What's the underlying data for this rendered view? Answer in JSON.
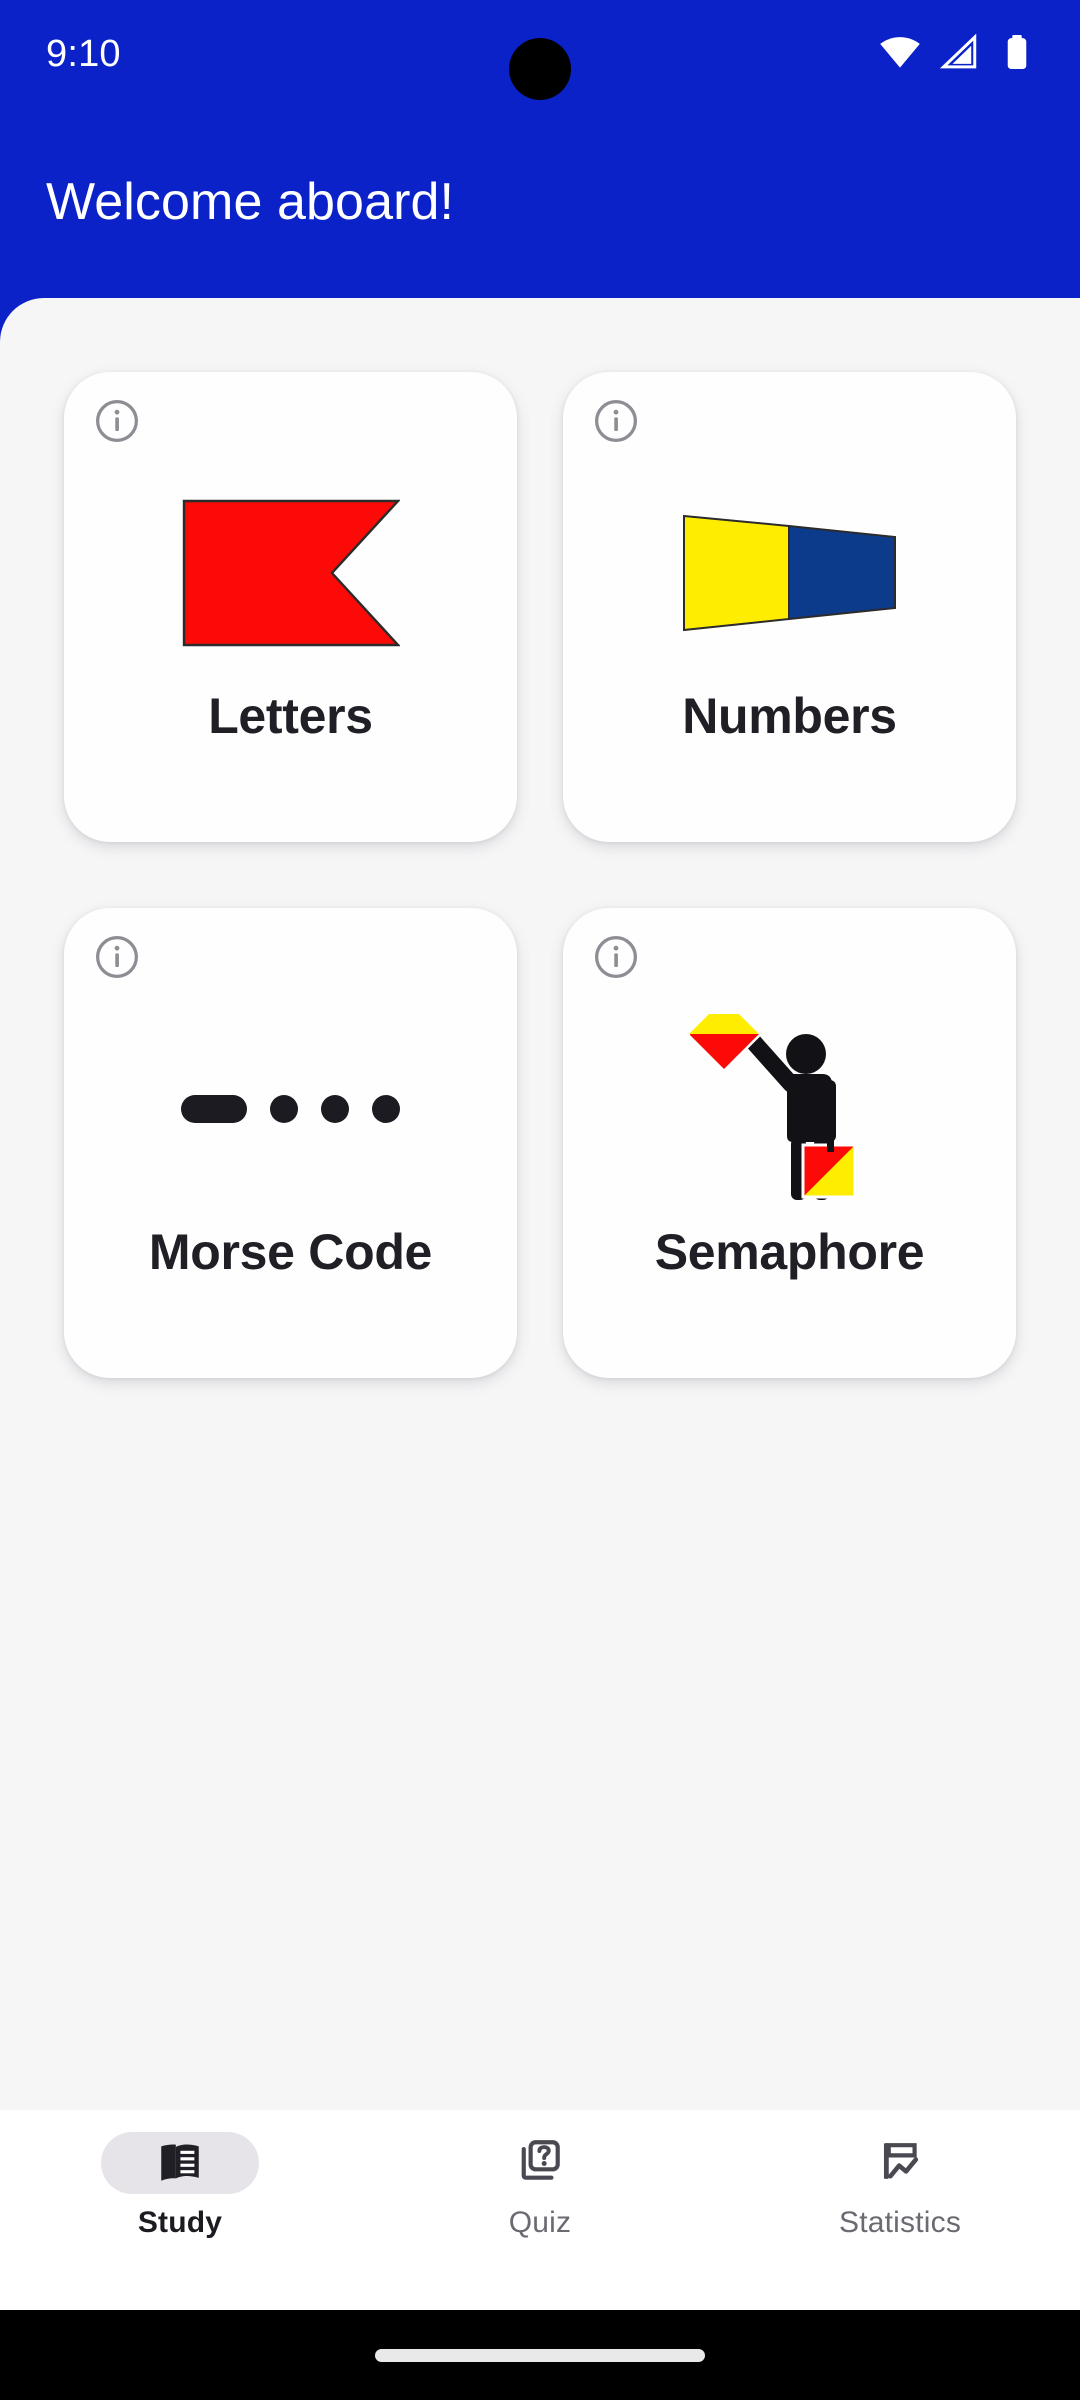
{
  "status_bar": {
    "clock": "9:10",
    "icons": [
      "wifi-icon",
      "cellular-signal-icon",
      "battery-icon"
    ],
    "wifi_level": "full",
    "cellular_level": "partial",
    "battery_level": "full"
  },
  "app_bar": {
    "title": "Welcome aboard!",
    "background_color": "#0B22C8",
    "text_color": "#FFFFFF"
  },
  "theme": {
    "primary": "#0B22C8",
    "sheet_background": "#F6F6F7",
    "card_background": "#FEFEFE",
    "text_primary": "#201F26",
    "text_muted": "#6B6972",
    "nav_active_pill": "#E6E4E9",
    "flag_red": "#FB0A07",
    "flag_yellow": "#FFED00",
    "flag_navy": "#0D3B8C",
    "morse_black": "#1C1B21",
    "info_gray": "#8E8D93"
  },
  "main": {
    "cards": [
      {
        "label": "Letters",
        "visual": "maritime-flag-b-swallowtail",
        "info_label": "info-icon",
        "colors": [
          "#FB0A07"
        ]
      },
      {
        "label": "Numbers",
        "visual": "maritime-numeral-pennant",
        "info_label": "info-icon",
        "colors": [
          "#FFED00",
          "#0D3B8C"
        ]
      },
      {
        "label": "Morse Code",
        "visual": "morse-dash-dot-dot-dot",
        "info_label": "info-icon",
        "pattern": "-...",
        "colors": [
          "#1C1B21"
        ]
      },
      {
        "label": "Semaphore",
        "visual": "semaphore-signaller-figure",
        "info_label": "info-icon",
        "colors": [
          "#FB0A07",
          "#FFED00",
          "#1C1B21"
        ]
      }
    ]
  },
  "bottom_nav": {
    "items": [
      {
        "label": "Study",
        "icon": "menu-book-icon",
        "active": true
      },
      {
        "label": "Quiz",
        "icon": "quiz-icon",
        "active": false
      },
      {
        "label": "Statistics",
        "icon": "flag-chart-icon",
        "active": false
      }
    ]
  },
  "gesture_bar": {
    "handle": "home-gesture-handle"
  }
}
